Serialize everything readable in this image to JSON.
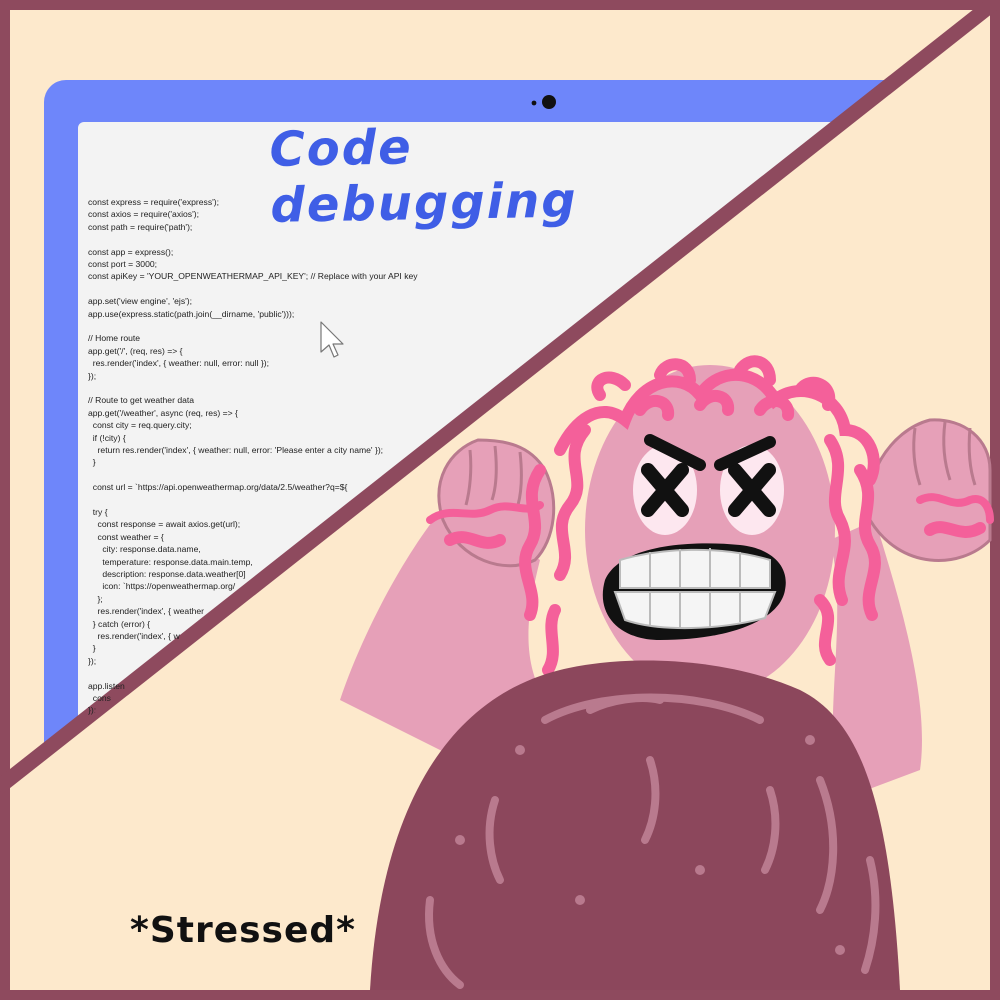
{
  "title": "Code debugging",
  "caption": "*Stressed*",
  "code_lines": [
    "const express = require('express');",
    "const axios = require('axios');",
    "const path = require('path');",
    "",
    "const app = express();",
    "const port = 3000;",
    "const apiKey = 'YOUR_OPENWEATHERMAP_API_KEY'; // Replace with your API key",
    "",
    "app.set('view engine', 'ejs');",
    "app.use(express.static(path.join(__dirname, 'public')));",
    "",
    "// Home route",
    "app.get('/', (req, res) => {",
    "  res.render('index', { weather: null, error: null });",
    "});",
    "",
    "// Route to get weather data",
    "app.get('/weather', async (req, res) => {",
    "  const city = req.query.city;",
    "  if (!city) {",
    "    return res.render('index', { weather: null, error: 'Please enter a city name' });",
    "  }",
    "",
    "  const url = `https://api.openweathermap.org/data/2.5/weather?q=${",
    "",
    "  try {",
    "    const response = await axios.get(url);",
    "    const weather = {",
    "      city: response.data.name,",
    "      temperature: response.data.main.temp,",
    "      description: response.data.weather[0]",
    "      icon: `https://openweathermap.org/",
    "    };",
    "    res.render('index', { weather",
    "  } catch (error) {",
    "    res.render('index', { w",
    "  }",
    "});",
    "",
    "app.listen",
    "  cons",
    "});"
  ],
  "colors": {
    "frame": "#8e4a5e",
    "background": "#fde9cc",
    "monitor": "#6e86fa",
    "screen": "#f3f3f3",
    "title": "#3f5ee6",
    "skin": "#e6a0b8",
    "hair": "#f4609a",
    "shirt": "#8c475c",
    "shirt_pattern": "#b97a8e"
  },
  "icons": [
    "camera-icon",
    "mouse-cursor-icon"
  ]
}
